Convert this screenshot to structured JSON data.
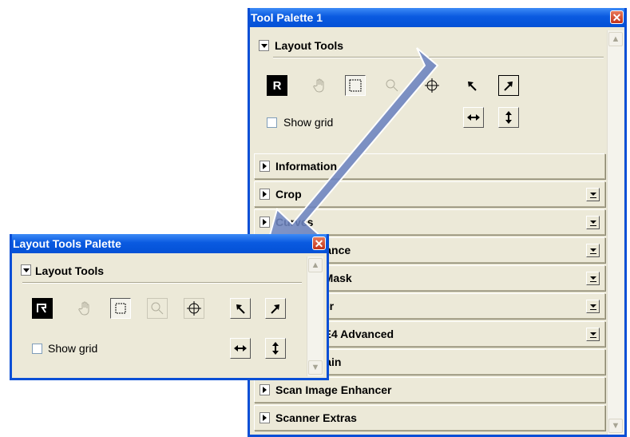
{
  "main_palette": {
    "title": "Tool Palette 1",
    "close": "✕",
    "layout_section": "Layout Tools",
    "show_grid": "Show grid",
    "sections": [
      {
        "label": "Information",
        "dropdown": false
      },
      {
        "label": "Crop",
        "dropdown": true
      },
      {
        "label": "Curves",
        "dropdown": true
      },
      {
        "label": "Color Balance",
        "dropdown": true
      },
      {
        "label": "Unsharp Mask",
        "dropdown": true
      },
      {
        "label": "LCH Editor",
        "dropdown": true
      },
      {
        "label": "Digital ICE4 Advanced",
        "dropdown": true
      },
      {
        "label": "Analog Gain",
        "dropdown": false
      },
      {
        "label": "Scan Image Enhancer",
        "dropdown": false
      },
      {
        "label": "Scanner Extras",
        "dropdown": false
      }
    ]
  },
  "layout_palette": {
    "title": "Layout Tools Palette",
    "close": "✕",
    "section": "Layout Tools",
    "show_grid": "Show grid"
  },
  "colors": {
    "title_blue": "#0a5ae0",
    "window_bg": "#ece9d8",
    "arrow": "#6d86c4"
  }
}
